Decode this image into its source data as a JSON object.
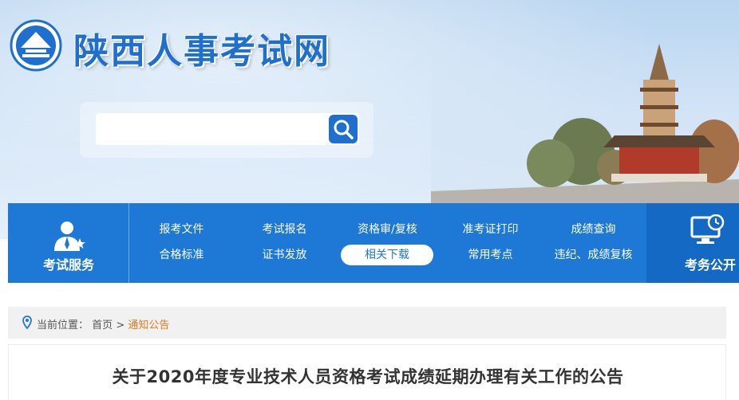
{
  "header": {
    "site_title": "陕西人事考试网",
    "search": {
      "placeholder": "",
      "value": ""
    }
  },
  "nav": {
    "left_label": "考试服务",
    "right_label": "考务公开",
    "row1": [
      "报考文件",
      "考试报名",
      "资格审/复核",
      "准考证打印",
      "成绩查询"
    ],
    "row2": [
      "合格标准",
      "证书发放",
      "相关下载",
      "常用考点",
      "违纪、成绩复核"
    ],
    "active": "相关下载"
  },
  "breadcrumb": {
    "prefix": "当前位置：",
    "home": "首页",
    "separator": ">",
    "current": "通知公告"
  },
  "article": {
    "title": "关于2020年度专业技术人员资格考试成绩延期办理有关工作的公告"
  },
  "colors": {
    "brand_blue": "#1e78d6",
    "nav_dark": "#1469c4",
    "breadcrumb_current": "#e07b1a"
  },
  "icons": [
    "logo-emblem",
    "search-icon",
    "user-star-icon",
    "monitor-clock-icon",
    "location-pin-icon"
  ]
}
